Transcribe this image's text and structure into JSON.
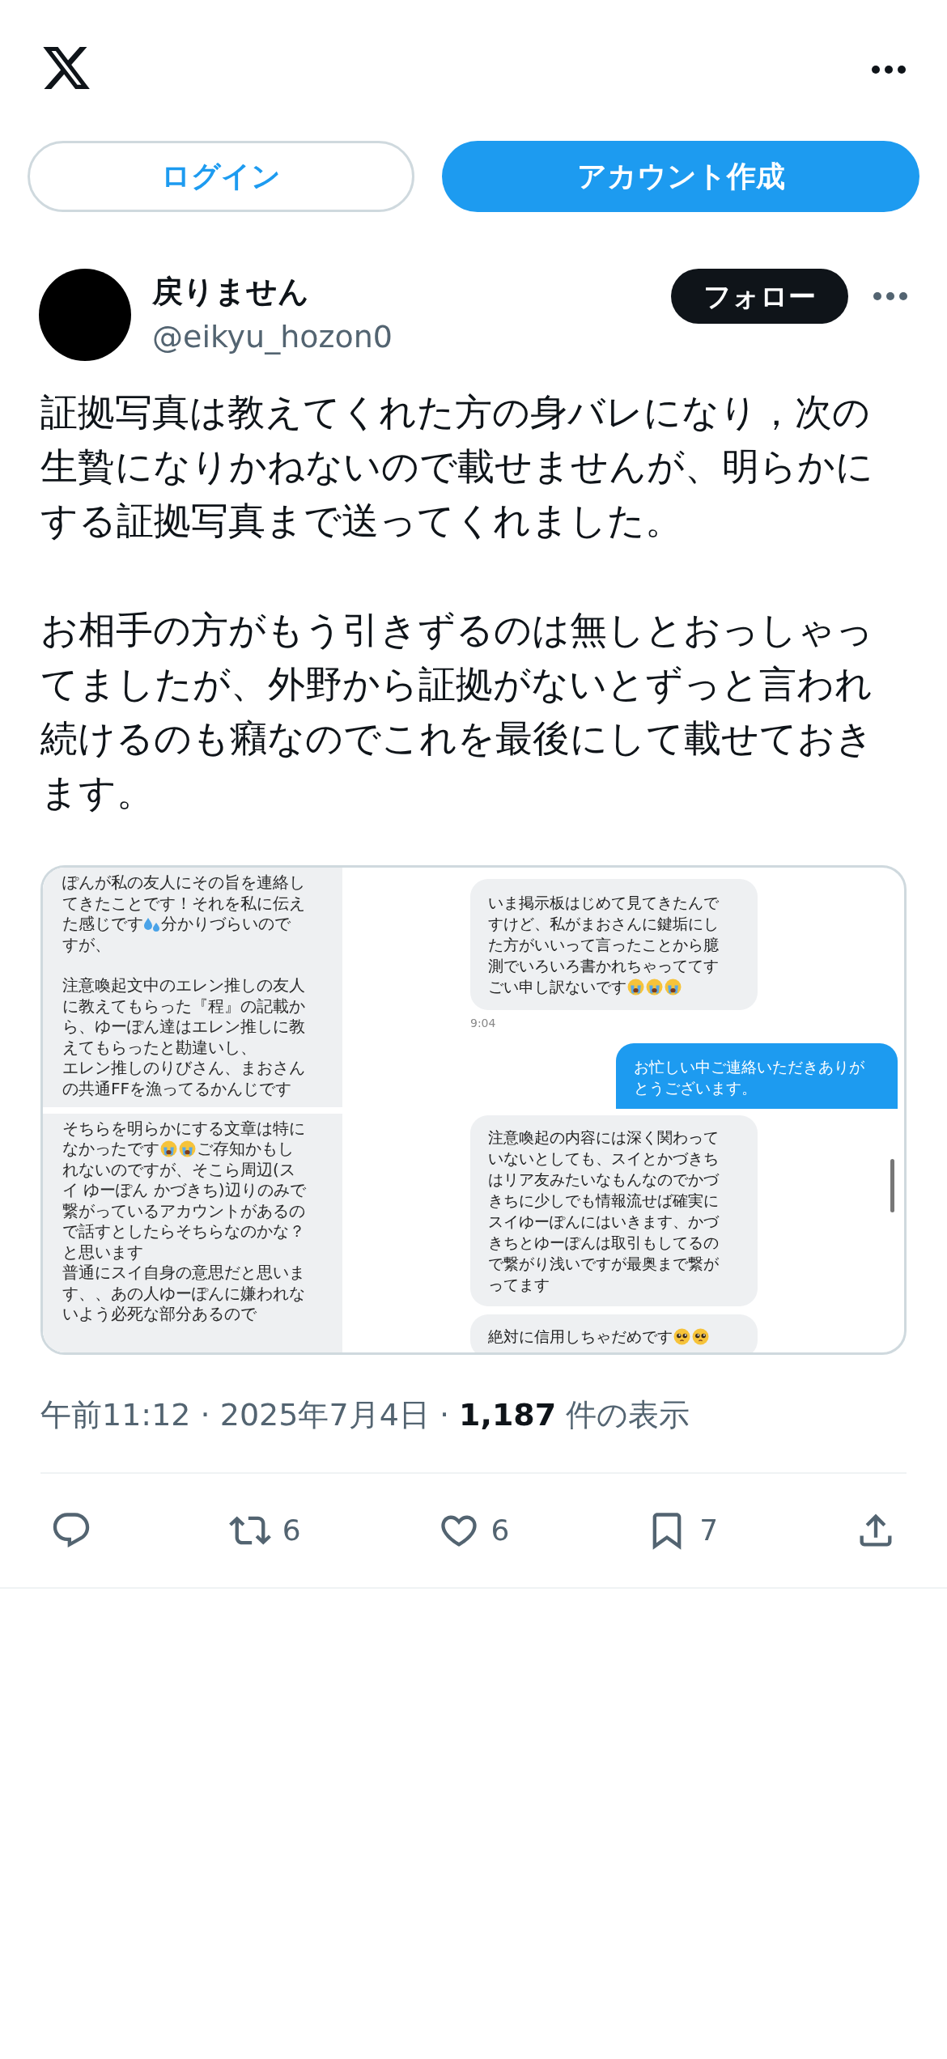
{
  "header": {
    "buttons": [
      {
        "kind": "outline",
        "label": "ログイン"
      },
      {
        "kind": "filled",
        "label": "アカウント作成"
      }
    ]
  },
  "author": {
    "name": "戻りません",
    "handle": "@eikyu_hozon0",
    "follow": "フォロー"
  },
  "body": [
    "証拠写真は教えてくれた方の身バレになり，次の生贄になりかねないので載せませんが、明らかにする証拠写真まで送ってくれました。",
    "お相手の方がもう引きずるのは無しとおっしゃってましたが、外野から証拠がないとずっと言われ続けるのも癪なのでこれを最後にして載せておきます。"
  ],
  "attachment": {
    "left_panels": [
      {
        "lines": [
          [
            {
              "kind": "text",
              "text": "ぽんが私の友人にその旨を連絡し"
            }
          ],
          [
            {
              "kind": "text",
              "text": "てきたことです！それを私に伝え"
            }
          ],
          [
            {
              "kind": "text",
              "text": "た感じです"
            },
            {
              "kind": "sweat"
            },
            {
              "kind": "text",
              "text": "分かりづらいので"
            }
          ],
          [
            {
              "kind": "text",
              "text": "すが、"
            }
          ],
          [
            {
              "kind": "gap"
            }
          ],
          [
            {
              "kind": "text",
              "text": "注意喚起文中のエレン推しの友人"
            }
          ],
          [
            {
              "kind": "text",
              "text": "に教えてもらった『程』の記載か"
            }
          ],
          [
            {
              "kind": "text",
              "text": "ら、ゆーぽん達はエレン推しに教"
            }
          ],
          [
            {
              "kind": "text",
              "text": "えてもらったと勘違いし、"
            }
          ],
          [
            {
              "kind": "text",
              "text": "エレン推しのりびさん、まおさん"
            }
          ],
          [
            {
              "kind": "text",
              "text": "の共通FFを漁ってるかんじです"
            }
          ]
        ]
      },
      {
        "lines": [
          [
            {
              "kind": "text",
              "text": "そちらを明らかにする文章は特に"
            }
          ],
          [
            {
              "kind": "text",
              "text": "なかったです"
            },
            {
              "kind": "crying"
            },
            {
              "kind": "crying"
            },
            {
              "kind": "text",
              "text": "ご存知かもし"
            }
          ],
          [
            {
              "kind": "text",
              "text": "れないのですが、そこら周辺(ス"
            }
          ],
          [
            {
              "kind": "text",
              "text": "イ ゆーぽん かづきち)辺りのみで"
            }
          ],
          [
            {
              "kind": "text",
              "text": "繋がっているアカウントがあるの"
            }
          ],
          [
            {
              "kind": "text",
              "text": "で話すとしたらそちらなのかな？"
            }
          ],
          [
            {
              "kind": "text",
              "text": "と思います"
            }
          ],
          [
            {
              "kind": "text",
              "text": "普通にスイ自身の意思だと思いま"
            }
          ],
          [
            {
              "kind": "text",
              "text": "す、、あの人ゆーぽんに嫌われな"
            }
          ],
          [
            {
              "kind": "text",
              "text": "いよう必死な部分あるので"
            }
          ]
        ]
      }
    ],
    "right_top": {
      "received": [
        [
          {
            "kind": "text",
            "text": "いま掲示板はじめて見てきたんで"
          }
        ],
        [
          {
            "kind": "text",
            "text": "すけど、私がまおさんに鍵垢にし"
          }
        ],
        [
          {
            "kind": "text",
            "text": "た方がいいって言ったことから臆"
          }
        ],
        [
          {
            "kind": "text",
            "text": "測でいろいろ書かれちゃっててす"
          }
        ],
        [
          {
            "kind": "text",
            "text": "ごい申し訳ないです"
          },
          {
            "kind": "crying"
          },
          {
            "kind": "crying"
          },
          {
            "kind": "crying"
          }
        ]
      ],
      "time": "9:04",
      "sent": [
        [
          {
            "kind": "text",
            "text": "お忙しい中ご連絡いただきありが"
          }
        ],
        [
          {
            "kind": "text",
            "text": "とうございます。"
          }
        ]
      ]
    },
    "right_bottom": {
      "bubbles": [
        [
          [
            {
              "kind": "text",
              "text": "注意喚起の内容には深く関わって"
            }
          ],
          [
            {
              "kind": "text",
              "text": "いないとしても、スイとかづきち"
            }
          ],
          [
            {
              "kind": "text",
              "text": "はリア友みたいなもんなのでかづ"
            }
          ],
          [
            {
              "kind": "text",
              "text": "きちに少しでも情報流せば確実に"
            }
          ],
          [
            {
              "kind": "text",
              "text": "スイゆーぽんにはいきます、かづ"
            }
          ],
          [
            {
              "kind": "text",
              "text": "きちとゆーぽんは取引もしてるの"
            }
          ],
          [
            {
              "kind": "text",
              "text": "で繋がり浅いですが最奥まで繋が"
            }
          ],
          [
            {
              "kind": "text",
              "text": "ってます"
            }
          ]
        ],
        [
          [
            {
              "kind": "text",
              "text": "絶対に信用しちゃだめです"
            },
            {
              "kind": "pleading"
            },
            {
              "kind": "pleading"
            }
          ]
        ]
      ]
    }
  },
  "meta": "午前11:12 · 2025年7月4日 · **1,187** 件の表示",
  "actions": [
    {
      "kind": "reply"
    },
    {
      "kind": "repost",
      "count": "6"
    },
    {
      "kind": "like",
      "count": "6"
    },
    {
      "kind": "bookmark",
      "count": "7"
    },
    {
      "kind": "share"
    }
  ]
}
